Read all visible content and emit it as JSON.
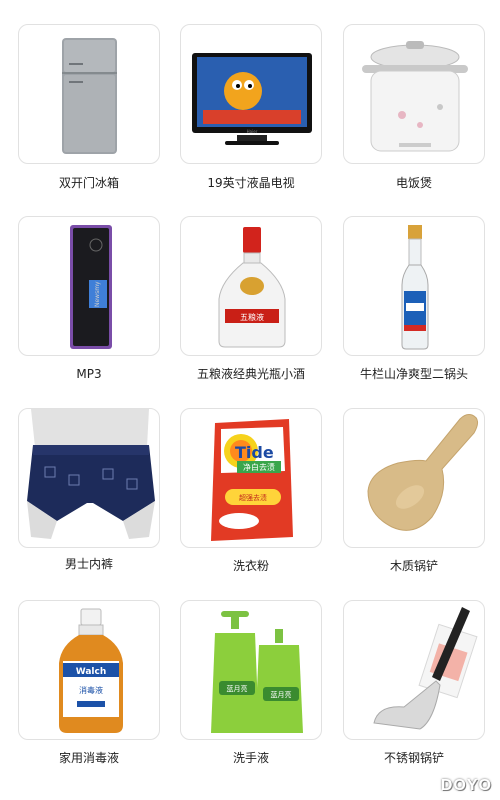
{
  "products": [
    {
      "name": "双开门冰箱",
      "icon": "refrigerator-icon"
    },
    {
      "name": "19英寸液晶电视",
      "icon": "lcd-tv-icon"
    },
    {
      "name": "电饭煲",
      "icon": "rice-cooker-icon"
    },
    {
      "name": "MP3",
      "icon": "mp3-player-icon"
    },
    {
      "name": "五粮液经典光瓶小酒",
      "icon": "liquor-bottle-icon"
    },
    {
      "name": "牛栏山净爽型二锅头",
      "icon": "erguotou-bottle-icon"
    },
    {
      "name": "男士内裤",
      "icon": "mens-underwear-icon"
    },
    {
      "name": "洗衣粉",
      "icon": "detergent-bag-icon"
    },
    {
      "name": "木质锅铲",
      "icon": "wooden-spatula-icon"
    },
    {
      "name": "家用消毒液",
      "icon": "disinfectant-bottle-icon"
    },
    {
      "name": "洗手液",
      "icon": "hand-soap-bottles-icon"
    },
    {
      "name": "不锈钢锅铲",
      "icon": "steel-spatula-icon"
    }
  ],
  "package_text": {
    "tv_brand": "Haier",
    "mp3_brand": "Newsmy",
    "wuliangye_label": "五粮液",
    "tide_brand": "Tide",
    "tide_cn": "净白去渍",
    "tide_promo": "超强去渍",
    "walch_brand": "Walch",
    "walch_cn": "消毒液",
    "soap_brand": "蓝月亮"
  },
  "watermark": "DOYO",
  "colors": {
    "card_border": "#e1e1e1",
    "caption": "#222222"
  }
}
